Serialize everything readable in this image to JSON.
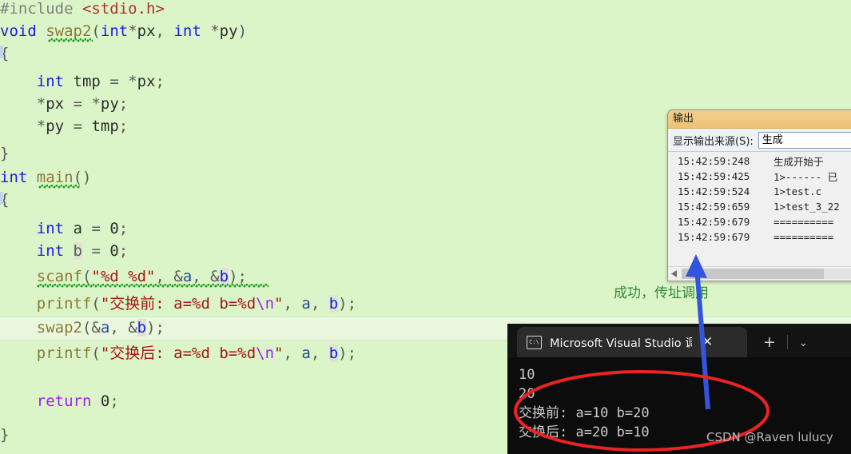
{
  "editor": {
    "name": "code-editor",
    "background": "#dcf5c8",
    "language": "c",
    "lines": [
      {
        "indent": 0,
        "text": "#include <stdio.h>"
      },
      {
        "indent": 0,
        "text": "void swap2(int*px, int *py)"
      },
      {
        "indent": 0,
        "text": "{"
      },
      {
        "indent": 0,
        "text": ""
      },
      {
        "indent": 1,
        "text": "int tmp = *px;"
      },
      {
        "indent": 1,
        "text": "*px = *py;"
      },
      {
        "indent": 1,
        "text": "*py = tmp;"
      },
      {
        "indent": 0,
        "text": "}"
      },
      {
        "indent": 0,
        "text": "int main()"
      },
      {
        "indent": 0,
        "text": "{"
      },
      {
        "indent": 0,
        "text": ""
      },
      {
        "indent": 1,
        "text": "int a = 0;"
      },
      {
        "indent": 1,
        "text": "int b = 0;"
      },
      {
        "indent": 1,
        "text": "scanf(\"%d %d\", &a, &b);"
      },
      {
        "indent": 1,
        "text": "printf(\"交换前: a=%d b=%d\\n\", a, b);"
      },
      {
        "indent": 1,
        "text": "swap2(&a, &b);"
      },
      {
        "indent": 1,
        "text": "printf(\"交换后: a=%d b=%d\\n\", a, b);"
      },
      {
        "indent": 0,
        "text": ""
      },
      {
        "indent": 1,
        "text": "return 0;"
      },
      {
        "indent": 0,
        "text": "}"
      }
    ],
    "current_line_index": 15
  },
  "output_window": {
    "title": "输出",
    "source_label": "显示输出来源(S):",
    "source_value": "生成",
    "log": [
      {
        "time": "15:42:59:248",
        "message": "生成开始于"
      },
      {
        "time": "15:42:59:425",
        "message": "1>------ 已"
      },
      {
        "time": "15:42:59:524",
        "message": "1>test.c"
      },
      {
        "time": "15:42:59:659",
        "message": "1>test_3_22"
      },
      {
        "time": "15:42:59:679",
        "message": "=========="
      },
      {
        "time": "15:42:59:679",
        "message": "=========="
      }
    ],
    "scroll_left_glyph": "◀"
  },
  "console": {
    "tab_title": "Microsoft Visual Studio 调试控",
    "tab_icon_text": "C:\\",
    "close_glyph": "✕",
    "new_tab_glyph": "+",
    "dropdown_glyph": "⌄",
    "lines": [
      "10",
      "20",
      "交换前: a=10 b=20",
      "交换后: a=20 b=10"
    ]
  },
  "annotations": {
    "green_note": "成功，传址调用",
    "green_color": "#2e8b3a",
    "arrow_color": "#3355dd",
    "ellipse_color": "#ee2222"
  },
  "watermark": {
    "text": "CSDN @Raven lulucy"
  }
}
